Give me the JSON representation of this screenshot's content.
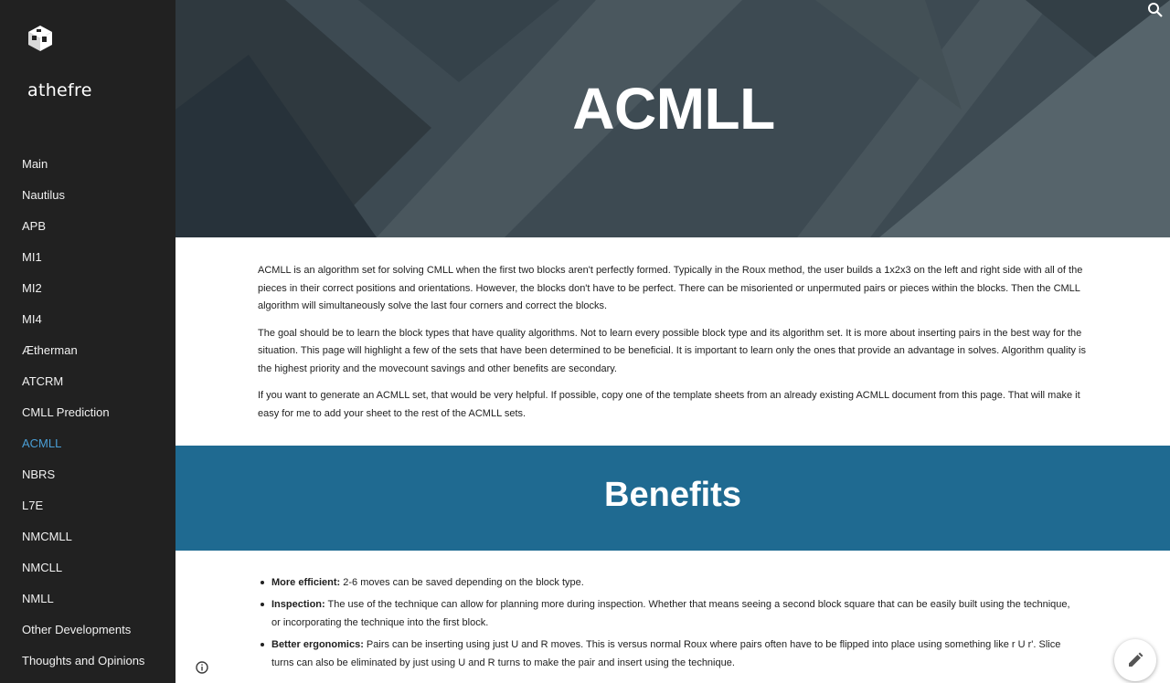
{
  "site": {
    "title": "athefre",
    "logo_icon": "cube-logo-icon"
  },
  "nav": {
    "items": [
      {
        "label": "Main"
      },
      {
        "label": "Nautilus"
      },
      {
        "label": "APB"
      },
      {
        "label": "MI1"
      },
      {
        "label": "MI2"
      },
      {
        "label": "MI4"
      },
      {
        "label": "Ætherman"
      },
      {
        "label": "ATCRM"
      },
      {
        "label": "CMLL Prediction"
      },
      {
        "label": "ACMLL",
        "active": true
      },
      {
        "label": "NBRS"
      },
      {
        "label": "L7E"
      },
      {
        "label": "NMCMLL"
      },
      {
        "label": "NMCLL"
      },
      {
        "label": "NMLL"
      },
      {
        "label": "Other Developments"
      },
      {
        "label": "Thoughts and Opinions"
      }
    ]
  },
  "header": {
    "title": "ACMLL",
    "search_icon": "search-icon"
  },
  "intro": {
    "paragraphs": [
      "ACMLL is an algorithm set for solving CMLL when the first two blocks aren't perfectly formed. Typically in the Roux method, the user builds a 1x2x3 on the left and right side with all of the pieces in their correct positions and orientations. However, the blocks don't have to be perfect. There can be misoriented or unpermuted pairs or pieces within the blocks. Then the CMLL algorithm will simultaneously solve the last four corners and correct the blocks.",
      "The goal should be to learn the block types that have quality algorithms. Not to learn every possible block type and its algorithm set. It is more about inserting pairs in the best way for the situation. This page will highlight a few of the sets that have been determined to be beneficial. It is important to learn only the ones that provide an advantage in solves. Algorithm quality is the highest priority and the movecount savings and other benefits are secondary.",
      "If you want to generate an ACMLL set, that would be very helpful. If possible, copy one of the template sheets from an already existing ACMLL document from this page. That will make it easy for me to add your sheet to the rest of the ACMLL sets."
    ]
  },
  "benefits": {
    "title": "Benefits",
    "items": [
      {
        "term": "More efficient:",
        "text": " 2-6 moves can be saved depending on the block type."
      },
      {
        "term": "Inspection:",
        "text": " The use of the technique can allow for planning more during inspection. Whether that means seeing a second block square that can be easily built using the technique, or incorporating the technique into the first block."
      },
      {
        "term": "Better ergonomics:",
        "text": " Pairs can be inserting using just U and R moves. This is versus normal Roux where pairs often have to be flipped into place using something like r U r'. Slice turns can also be eliminated by just using U and R turns to make the pair and insert using the technique."
      }
    ]
  },
  "colors": {
    "sidebar": "#212121",
    "active_link": "#4a9fd6",
    "band": "#1f6a91",
    "hero": "#3c4a52"
  },
  "icons": {
    "info": "info-icon",
    "edit": "pencil-icon"
  }
}
